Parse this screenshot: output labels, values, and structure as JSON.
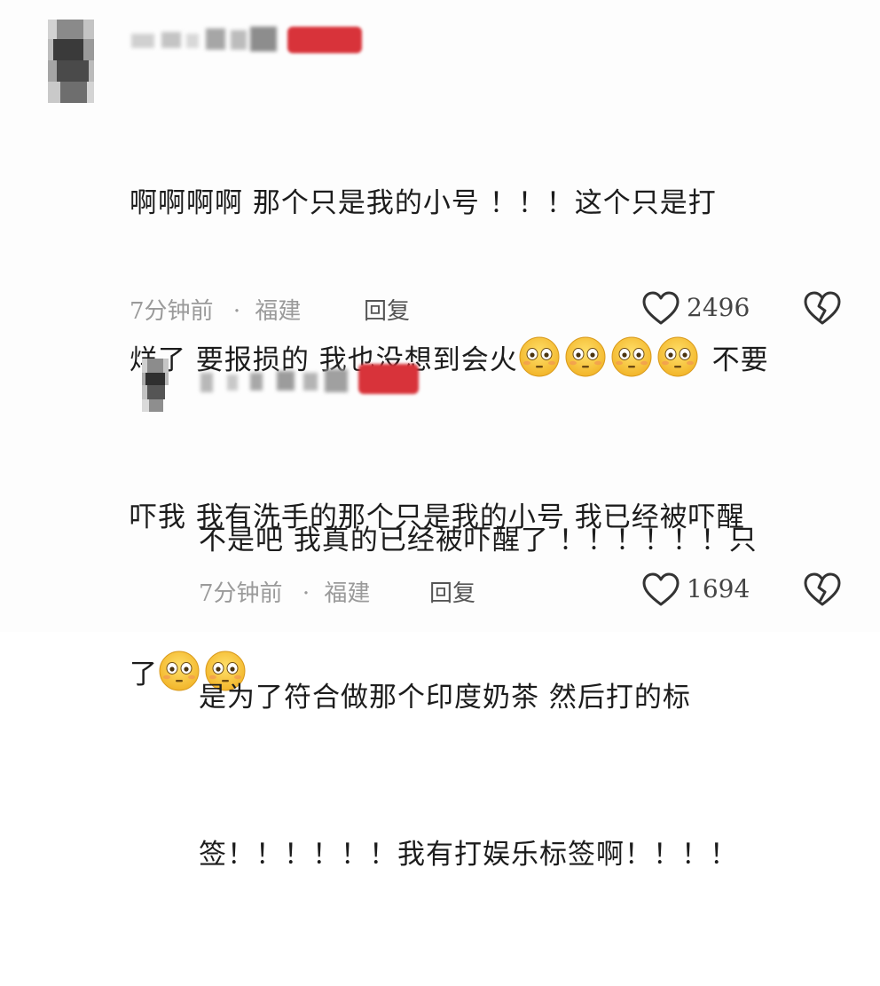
{
  "comments": [
    {
      "text_lines": [
        "啊啊啊啊 那个只是我的小号 ！！！这个只是打",
        "烊了 要报损的 我也没想到会火",
        "吓我 我有洗手的那个只是我的小号 我已经被吓醒",
        "了"
      ],
      "line2_tail": "不要",
      "emoji_name": "flushed-face-icon",
      "time": "7分钟前",
      "location": "福建",
      "separator": "·",
      "reply_label": "回复",
      "likes": "2496"
    },
    {
      "text_lines": [
        "不是吧 我真的已经被吓醒了 ！！！！！！只",
        "是为了符合做那个印度奶茶 然后打的标",
        "签！！！！！！我有打娱乐标签啊！！！！"
      ],
      "time": "7分钟前",
      "location": "福建",
      "separator": "·",
      "reply_label": "回复",
      "likes": "1694"
    }
  ],
  "colors": {
    "badge": "#d8333a",
    "meta_text": "#9a9a9a",
    "like_icon": "#333333"
  }
}
